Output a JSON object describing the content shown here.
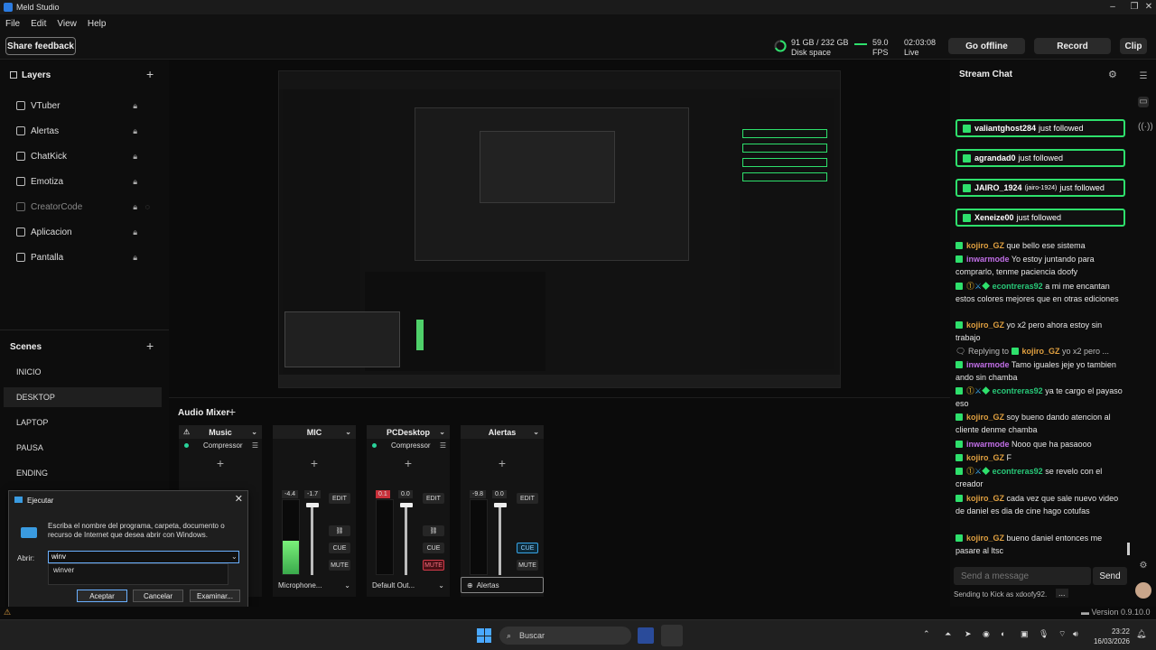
{
  "window": {
    "title": "Meld Studio",
    "controls": [
      "–",
      "❐",
      "✕"
    ]
  },
  "menu": [
    "File",
    "Edit",
    "View",
    "Help"
  ],
  "toolbar": {
    "share_feedback": "Share feedback",
    "disk_value": "91 GB / 232 GB",
    "disk_label": "Disk space",
    "fps_value": "59.0",
    "fps_label": "FPS",
    "live_time": "02:03:08",
    "live_label": "Live",
    "go_offline": "Go offline",
    "record": "Record",
    "clip": "Clip"
  },
  "layers": {
    "title": "Layers",
    "add": "+",
    "items": [
      {
        "label": "VTuber",
        "dim": false
      },
      {
        "label": "Alertas",
        "dim": false
      },
      {
        "label": "ChatKick",
        "dim": false
      },
      {
        "label": "Emotiza",
        "dim": false
      },
      {
        "label": "CreatorCode",
        "dim": true
      },
      {
        "label": "Aplicacion",
        "dim": false
      },
      {
        "label": "Pantalla",
        "dim": false
      }
    ]
  },
  "scenes": {
    "title": "Scenes",
    "add": "+",
    "items": [
      "INICIO",
      "DESKTOP",
      "LAPTOP",
      "PAUSA",
      "ENDING"
    ],
    "active": "DESKTOP"
  },
  "mixer": {
    "title": "Audio Mixer",
    "add": "+",
    "strips": [
      {
        "name": "Music",
        "effect": "Compressor",
        "device": "",
        "level_l": "",
        "level_r": "",
        "meter": 0,
        "mute_on": false,
        "cue_on": false
      },
      {
        "name": "MIC",
        "effect": "",
        "device": "Microphone...",
        "level_l": "-4.4",
        "level_r": "-1.7",
        "meter": 0.45,
        "mute_on": false,
        "cue_on": false
      },
      {
        "name": "PCDesktop",
        "effect": "Compressor",
        "device": "Default Out...",
        "level_l": "0.1",
        "level_r": "0.0",
        "meter": 0.0,
        "mute_on": true,
        "cue_on": false
      },
      {
        "name": "Alertas",
        "effect": "",
        "device": "Alertas",
        "level_l": "-9.8",
        "level_r": "0.0",
        "meter": 0.0,
        "mute_on": false,
        "cue_on": true
      }
    ],
    "btn_edit": "EDIT",
    "btn_cue": "CUE",
    "btn_mute": "MUTE"
  },
  "chat": {
    "title": "Stream Chat",
    "follows": [
      {
        "user": "valiantghost284",
        "text": "just followed"
      },
      {
        "user": "agrandad0",
        "text": "just followed"
      },
      {
        "user": "JAIRO_1924",
        "extra": "(jairo-1924)",
        "text": "just followed"
      },
      {
        "user": "Xeneize00",
        "text": "just followed"
      }
    ],
    "messages": [
      {
        "user": "kojiro_GZ",
        "color": "o",
        "text": "que bello ese sistema"
      },
      {
        "user": "inwarmode",
        "color": "p",
        "text": "Yo estoy juntando para comprarlo, tenme paciencia doofy"
      },
      {
        "user": "econtreras92",
        "color": "gr",
        "text": "a mi me encantan estos colores mejores que en otras ediciones"
      },
      {
        "user": "kojiro_GZ",
        "color": "o",
        "text": "yo x2 pero ahora estoy sin trabajo"
      },
      {
        "user": "kojiro_GZ",
        "color": "o",
        "text": "yo x2 pero ...",
        "reply": "Replying to"
      },
      {
        "user": "inwarmode",
        "color": "p",
        "text": "Tamo iguales jeje yo tambien ando sin chamba"
      },
      {
        "user": "econtreras92",
        "color": "gr",
        "text": "ya te cargo el payaso eso"
      },
      {
        "user": "kojiro_GZ",
        "color": "o",
        "text": "soy bueno dando atencion al cliente denme chamba"
      },
      {
        "user": "inwarmode",
        "color": "p",
        "text": "Nooo que ha pasaooo"
      },
      {
        "user": "kojiro_GZ",
        "color": "o",
        "text": "F"
      },
      {
        "user": "econtreras92",
        "color": "gr",
        "text": "se revelo con el creador"
      },
      {
        "user": "kojiro_GZ",
        "color": "o",
        "text": "cada vez que sale nuevo video de daniel es dia de cine hago cotufas"
      },
      {
        "user": "kojiro_GZ",
        "color": "o",
        "text": "bueno daniel entonces me pasare al ltsc"
      }
    ],
    "input_placeholder": "Send a message",
    "send": "Send",
    "sending_as": "Sending to Kick as xdoofy92.",
    "more": "..."
  },
  "run_dialog": {
    "title": "Ejecutar",
    "description": "Escriba el nombre del programa, carpeta, documento o recurso de Internet que desea abrir con Windows.",
    "label": "Abrir:",
    "value": "winv",
    "suggestion": "winver",
    "ok": "Aceptar",
    "cancel": "Cancelar",
    "browse": "Examinar..."
  },
  "status": {
    "version": "Version 0.9.10.0"
  },
  "taskbar": {
    "search": "Buscar",
    "time": "23:22",
    "date": "16/03/2026"
  },
  "colors": {
    "follow_green": "#2ee06c",
    "accent_blue": "#38a4e6",
    "mute_red": "#d23a4a"
  }
}
